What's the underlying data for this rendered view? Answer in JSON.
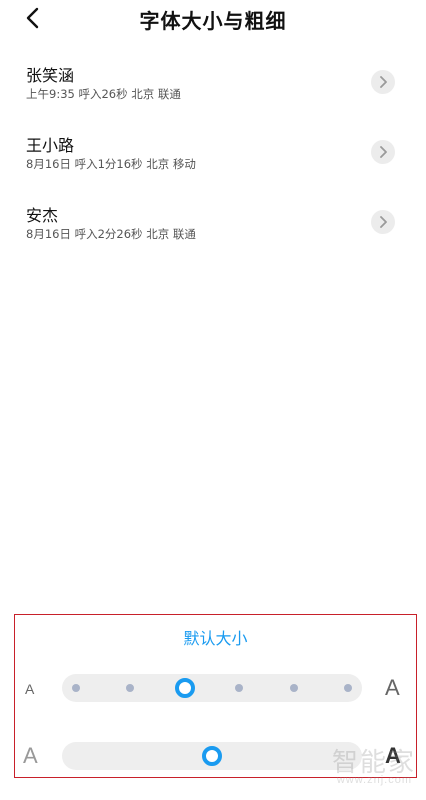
{
  "header": {
    "title": "字体大小与粗细"
  },
  "calls": [
    {
      "name": "张笑涵",
      "detail": "上午9:35 呼入26秒 北京 联通"
    },
    {
      "name": "王小路",
      "detail": "8月16日 呼入1分16秒 北京 移动"
    },
    {
      "name": "安杰",
      "detail": "8月16日 呼入2分26秒 北京 联通"
    }
  ],
  "font_panel": {
    "title": "默认大小",
    "size_slider": {
      "min_label": "A",
      "max_label": "A",
      "steps": 6,
      "selected_step": 2
    },
    "weight_slider": {
      "min_label": "A",
      "max_label": "A",
      "value_fraction": 0.5
    }
  },
  "watermark": {
    "logo": "智能家",
    "url": "www.znj.com"
  },
  "colors": {
    "accent": "#1a9bf0",
    "dot": "#a9b3c8",
    "track": "#eeeeee",
    "panel_border": "#c8202a"
  },
  "icons": {
    "back": "chevron-left-icon",
    "row_arrow": "chevron-right-icon"
  }
}
